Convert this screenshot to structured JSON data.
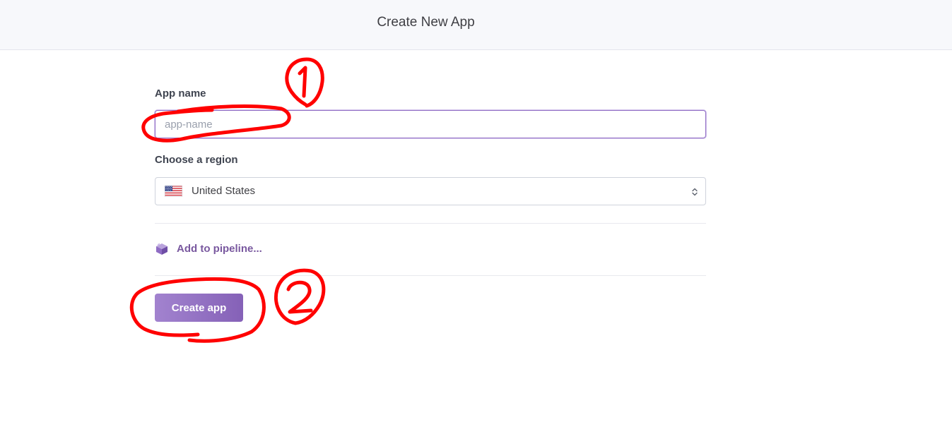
{
  "header": {
    "title": "Create New App"
  },
  "form": {
    "app_name": {
      "label": "App name",
      "value": "",
      "placeholder": "app-name"
    },
    "region": {
      "label": "Choose a region",
      "selected": "United States",
      "flag_icon": "us-flag-icon"
    },
    "pipeline": {
      "label": "Add to pipeline...",
      "icon": "pipeline-cube-icon"
    },
    "submit": {
      "label": "Create app"
    }
  },
  "annotations": {
    "marker_1": "1",
    "marker_2": "2",
    "color": "#ff0000"
  },
  "colors": {
    "accent": "#79589f",
    "button_start": "#a283cf",
    "button_end": "#8561b7",
    "header_bg": "#f7f8fb"
  }
}
